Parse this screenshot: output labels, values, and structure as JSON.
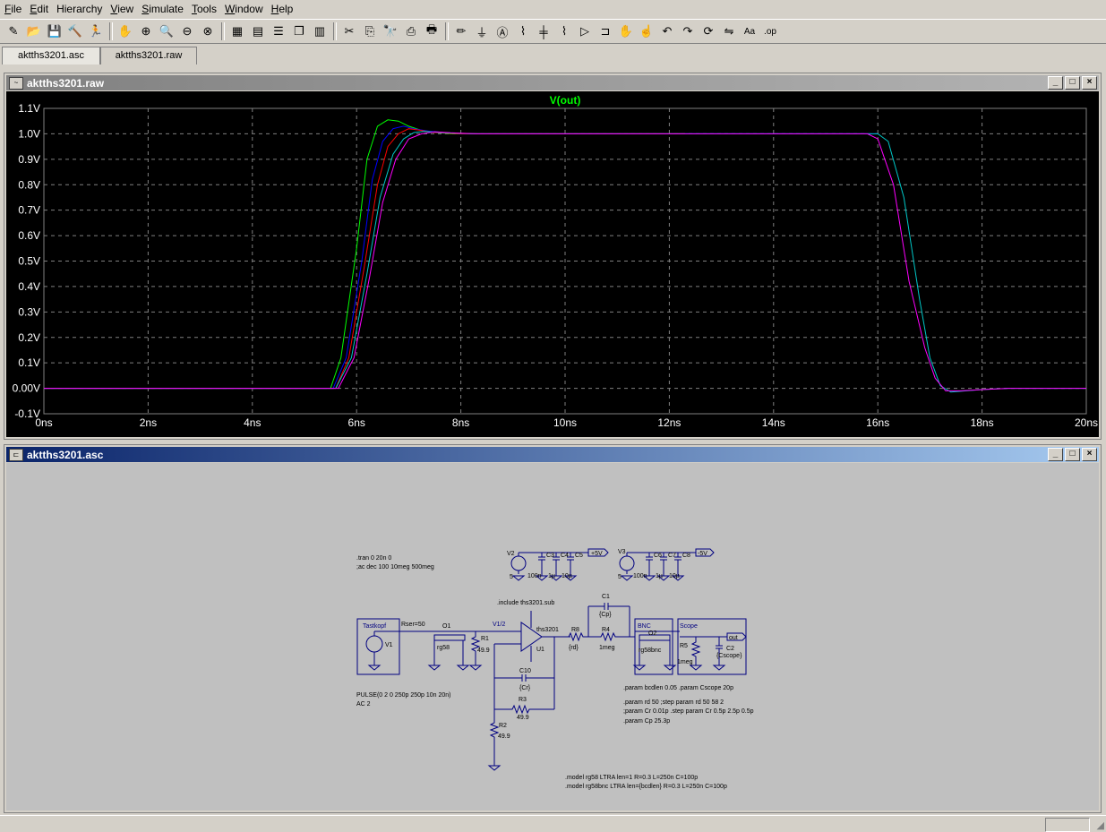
{
  "menu": [
    "File",
    "Edit",
    "Hierarchy",
    "View",
    "Simulate",
    "Tools",
    "Window",
    "Help"
  ],
  "menu_underline": [
    "F",
    "E",
    "",
    "V",
    "S",
    "T",
    "W",
    "H"
  ],
  "toolbar_icons": [
    "new-schematic-icon",
    "open-icon",
    "save-icon",
    "control-panel-icon",
    "run-icon",
    "halt-icon",
    "zoom-in-icon",
    "zoom-pan-icon",
    "zoom-out-icon",
    "zoom-cancel-icon",
    "autorange-icon",
    "manual-limits-icon",
    "tile-horizontal-icon",
    "cascade-icon",
    "tile-vertical-icon",
    "cut-icon",
    "copy-icon",
    "find-icon",
    "print-preview-icon",
    "print-icon",
    "wire-icon",
    "ground-icon",
    "label-icon",
    "resistor-icon",
    "capacitor-icon",
    "inductor-icon",
    "diode-icon",
    "component-icon",
    "move-icon",
    "drag-icon",
    "undo-icon",
    "redo-icon",
    "rotate-icon",
    "mirror-icon",
    "text-icon",
    "spice-directive-icon"
  ],
  "tabs": [
    "aktths3201.asc",
    "aktths3201.raw"
  ],
  "waveform_window": {
    "title": "aktths3201.raw",
    "trace_label": "V(out)",
    "trace_color": "#00ff00"
  },
  "schematic_window": {
    "title": "aktths3201.asc",
    "texts": {
      "tran": ".tran 0 20n 0",
      "ac": ";ac dec 100 10meg 500meg",
      "v2": "V2",
      "v2_val": "5",
      "c2a": "100n",
      "c2b": "C3",
      "c2c": "C4",
      "c2d": "C5",
      "c2b_val": "1µ",
      "c2c_val": "10µ",
      "plus5": "+5V",
      "v3": "V3",
      "v3_val": "5",
      "c3a": "100n",
      "c3b": "C6",
      "c3c": "C7",
      "c3d": "C8",
      "c3b_val": "1µ",
      "c3c_val": "10µ",
      "minus5": "-5V",
      "include": ".include ths3201.sub",
      "c1": "C1",
      "cp": "{Cp}",
      "tastkopf": "Tastkopf",
      "v1": "V1",
      "rser": "Rser=50",
      "o1": "O1",
      "rg58": "rg58",
      "r1": "R1",
      "r1_val": "49.9",
      "v12": "V1/2",
      "ths": "ths3201",
      "u1": "U1",
      "r8": "R8",
      "rd": "{rd}",
      "r4": "R4",
      "r4_val": "1meg",
      "bnc": "BNC",
      "o2": "O2",
      "rg58bnc": "rg58bnc",
      "scope": "Scope",
      "r5": "R5",
      "r5_val": "1meg",
      "c2": "C2",
      "cscope": "{Cscope}",
      "out": "out",
      "c10": "C10",
      "cr": "{Cr}",
      "r3": "R3",
      "r3_val": "49.9",
      "r2": "R2",
      "r2_val": "49.9",
      "pulse": "PULSE(0 2 0 250p 250p 10n 20n)",
      "ac2": "AC 2",
      "param1": ".param bcdlen 0.05   .param Cscope 20p",
      "param2": ".param rd 50       ;step param rd 50 58 2",
      "param3": ";param Cr 0.01p .step param Cr 0.5p 2.5p 0.5p",
      "param4": ".param Cp 25.3p",
      "model1": ".model rg58 LTRA len=1 R=0.3 L=250n C=100p",
      "model2": ".model rg58bnc LTRA len={bcdlen} R=0.3 L=250n C=100p"
    }
  },
  "chart_data": {
    "type": "line",
    "title": "V(out)",
    "xlabel": "",
    "ylabel": "",
    "xlim": [
      0,
      20
    ],
    "ylim": [
      -0.1,
      1.1
    ],
    "x_unit": "ns",
    "y_unit": "V",
    "xticks": [
      "0ns",
      "2ns",
      "4ns",
      "6ns",
      "8ns",
      "10ns",
      "12ns",
      "14ns",
      "16ns",
      "18ns",
      "20ns"
    ],
    "yticks": [
      "-0.1V",
      "0.00V",
      "0.1V",
      "0.2V",
      "0.3V",
      "0.4V",
      "0.5V",
      "0.6V",
      "0.7V",
      "0.8V",
      "0.9V",
      "1.0V",
      "1.1V"
    ],
    "grid": true,
    "series": [
      {
        "color": "#00ff00",
        "x": [
          0,
          5.5,
          5.7,
          6.0,
          6.2,
          6.4,
          6.6,
          6.8,
          7.0,
          7.3,
          7.8,
          8.5,
          10,
          12.3
        ],
        "y": [
          0,
          0,
          0.12,
          0.55,
          0.9,
          1.03,
          1.055,
          1.05,
          1.03,
          1.01,
          1.0,
          1.0,
          1.0,
          1.0
        ]
      },
      {
        "color": "#0000ff",
        "x": [
          0,
          5.55,
          5.8,
          6.1,
          6.3,
          6.5,
          6.7,
          6.9,
          7.1,
          7.4,
          8.0,
          10,
          16
        ],
        "y": [
          0,
          0,
          0.12,
          0.5,
          0.82,
          0.97,
          1.02,
          1.03,
          1.02,
          1.01,
          1.0,
          1.0,
          1.0
        ]
      },
      {
        "color": "#ff0000",
        "x": [
          0,
          5.6,
          5.85,
          6.15,
          6.4,
          6.6,
          6.8,
          7.0,
          7.2,
          7.5,
          8.0,
          10,
          12.3
        ],
        "y": [
          0,
          0,
          0.12,
          0.48,
          0.8,
          0.95,
          1.0,
          1.02,
          1.015,
          1.005,
          1.0,
          1.0,
          1.0
        ]
      },
      {
        "color": "#00c8c8",
        "x": [
          0,
          5.6,
          5.9,
          6.2,
          6.45,
          6.7,
          6.9,
          7.1,
          7.3,
          7.6,
          8.2,
          10,
          16,
          16.2,
          16.5,
          16.8,
          17.0,
          17.2,
          17.4,
          17.7,
          18.0,
          18.5,
          20
        ],
        "y": [
          0,
          0,
          0.12,
          0.45,
          0.75,
          0.92,
          0.98,
          1.005,
          1.01,
          1.005,
          1.0,
          1.0,
          1.0,
          0.97,
          0.75,
          0.35,
          0.12,
          0.01,
          -0.015,
          -0.01,
          -0.005,
          0,
          0
        ]
      },
      {
        "color": "#ff00ff",
        "x": [
          0,
          5.65,
          5.95,
          6.25,
          6.5,
          6.75,
          7.0,
          7.25,
          7.5,
          7.8,
          8.3,
          10,
          15.8,
          16.0,
          16.3,
          16.6,
          16.9,
          17.1,
          17.3,
          17.6,
          18.0,
          18.5,
          20
        ],
        "y": [
          0,
          0,
          0.12,
          0.44,
          0.73,
          0.9,
          0.98,
          1.0,
          1.008,
          1.004,
          1.0,
          1.0,
          1.0,
          0.98,
          0.8,
          0.42,
          0.16,
          0.04,
          -0.01,
          -0.01,
          -0.005,
          0,
          0
        ]
      }
    ]
  }
}
